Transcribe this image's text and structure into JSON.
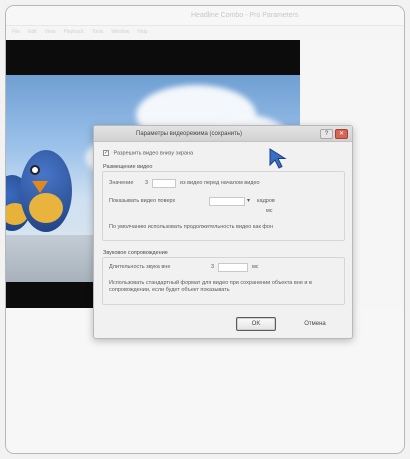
{
  "window": {
    "title": "Headline Combo - Pro Parameters",
    "menu": [
      "File",
      "Edit",
      "View",
      "Playback",
      "Tools",
      "Window",
      "Help"
    ]
  },
  "dialog": {
    "title": "Параметры видеорежима (сохранить)",
    "checkbox_top": {
      "label": "Разрешить видео внизу экрана",
      "checked": true
    },
    "section_video": {
      "heading": "Размещение видео",
      "row1_prefix": "Значение",
      "row1_value": "3",
      "row1_suffix": "из видео перед началом видео",
      "row2_prefix": "Показывать видео поверх",
      "row2_select": "",
      "row2_suffix": "кадров",
      "row2_unit": "мс",
      "row3": "По умолчанию использовать продолжительность видео как фон"
    },
    "section_sound": {
      "heading": "Звуковое сопровождение",
      "row1_prefix": "Длительность звука вне",
      "row1_value": "3",
      "row1_suffix": "мс",
      "row2": "Использовать стандартный формат для видео при сохранении объекта вне и в сопровождении, если будет объект показывать"
    },
    "ok_label": "OK",
    "cancel_label": "Отмена"
  },
  "colors": {
    "accent_cursor": "#3a6fc7",
    "close_button": "#d96455"
  }
}
